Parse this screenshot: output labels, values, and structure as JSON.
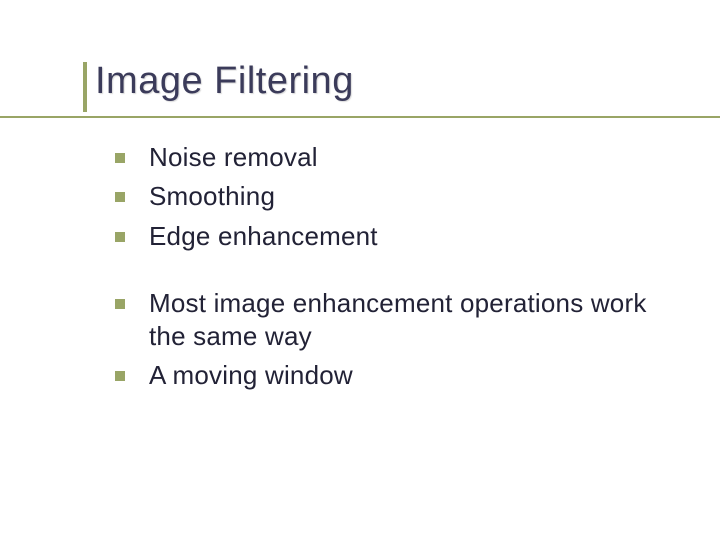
{
  "slide": {
    "title": "Image Filtering",
    "group1": {
      "items": [
        {
          "text": "Noise removal"
        },
        {
          "text": "Smoothing"
        },
        {
          "text": "Edge enhancement"
        }
      ]
    },
    "group2": {
      "items": [
        {
          "text": "Most image enhancement operations work the same way"
        },
        {
          "text": "A moving window"
        }
      ]
    }
  }
}
